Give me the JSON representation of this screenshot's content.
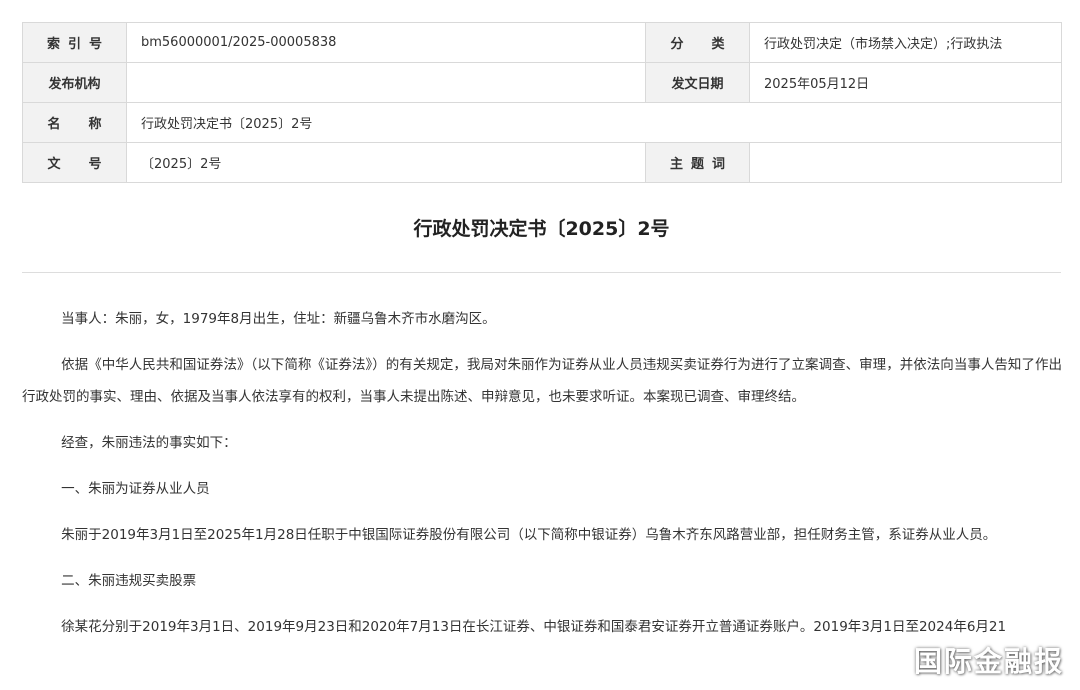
{
  "meta": {
    "index_label": "索引号",
    "index_value": "bm56000001/2025-00005838",
    "category_label": "分类",
    "category_value": "行政处罚决定（市场禁入决定）;行政执法",
    "issuer_label": "发布机构",
    "issuer_value": "",
    "date_label": "发文日期",
    "date_value": "2025年05月12日",
    "name_label": "名称",
    "name_value": "行政处罚决定书〔2025〕2号",
    "docnum_label": "文号",
    "docnum_value": "〔2025〕2号",
    "keywords_label": "主题词",
    "keywords_value": ""
  },
  "document": {
    "title": "行政处罚决定书〔2025〕2号",
    "paragraphs": [
      "当事人：朱丽，女，1979年8月出生，住址：新疆乌鲁木齐市水磨沟区。",
      "依据《中华人民共和国证券法》（以下简称《证券法》）的有关规定，我局对朱丽作为证券从业人员违规买卖证券行为进行了立案调查、审理，并依法向当事人告知了作出行政处罚的事实、理由、依据及当事人依法享有的权利，当事人未提出陈述、申辩意见，也未要求听证。本案现已调查、审理终结。",
      "经查，朱丽违法的事实如下：",
      "一、朱丽为证券从业人员",
      "朱丽于2019年3月1日至2025年1月28日任职于中银国际证券股份有限公司（以下简称中银证券）乌鲁木齐东风路营业部，担任财务主管，系证券从业人员。",
      "二、朱丽违规买卖股票",
      "徐某花分别于2019年3月1日、2019年9月23日和2020年7月13日在长江证券、中银证券和国泰君安证券开立普通证券账户。2019年3月1日至2024年6月21"
    ]
  },
  "watermark": "国际金融报"
}
